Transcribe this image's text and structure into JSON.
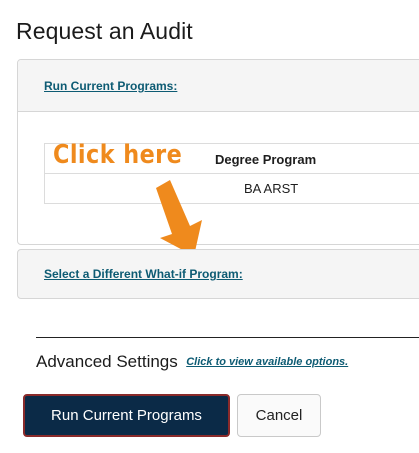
{
  "page": {
    "title": "Request an Audit"
  },
  "current_programs": {
    "link_label": "Run Current Programs:",
    "table": {
      "columns": [
        "Degree Program"
      ],
      "rows": [
        [
          "BA ARST"
        ]
      ]
    }
  },
  "annotation": {
    "text": "Click here",
    "color": "#ef8a1d",
    "arrow_icon": "arrow-down-left-icon"
  },
  "whatif": {
    "link_label": "Select a Different What-if Program:"
  },
  "advanced": {
    "label": "Advanced Settings",
    "link_label": "Click to view available options."
  },
  "buttons": {
    "run_label": "Run Current Programs",
    "cancel_label": "Cancel"
  },
  "colors": {
    "link": "#0d5b73",
    "primary_button": "#0b2a47"
  }
}
